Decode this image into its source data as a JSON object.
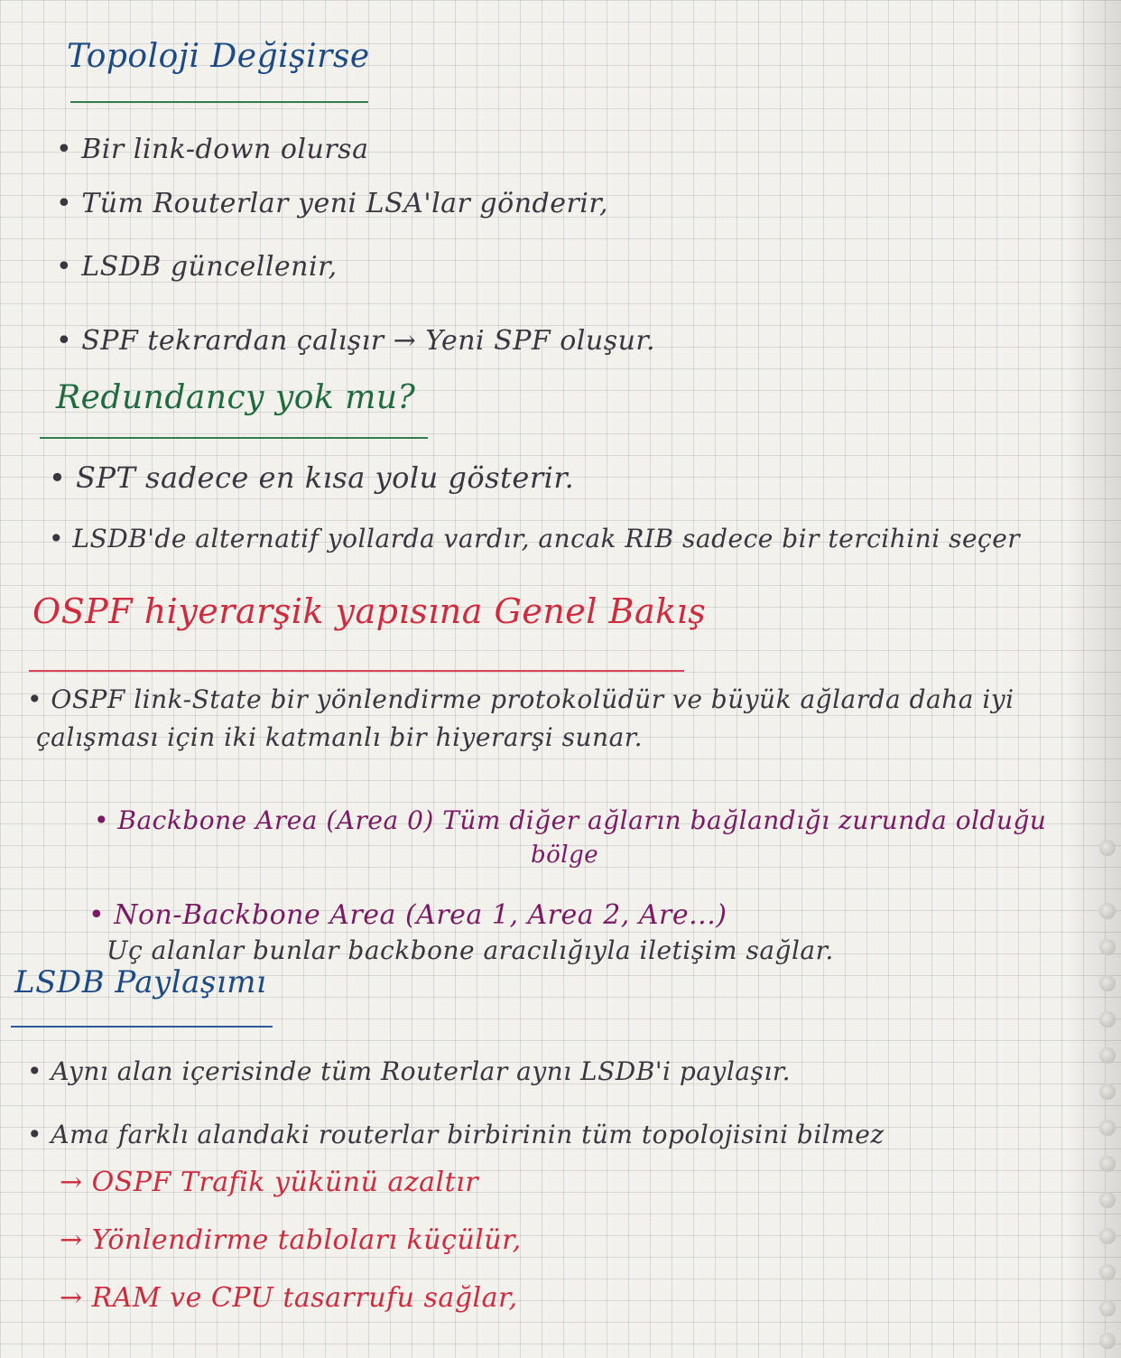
{
  "sections": [
    {
      "id": "topoloji",
      "heading": "Topoloji Değişirse",
      "lines": [
        "• Bir link-down olursa",
        "• Tüm Routerlar yeni LSA'lar gönderir,",
        "• LSDB güncellenir,",
        "• SPF tekrardan çalışır → Yeni SPF oluşur."
      ]
    },
    {
      "id": "redundancy",
      "heading": "Redundancy yok mu?",
      "lines": [
        "• SPT sadece en kısa yolu gösterir.",
        "• LSDB'de alternatif yollarda vardır, ancak RIB sadece bir tercihini seçer"
      ]
    },
    {
      "id": "ospf",
      "heading": "OSPF hiyerarşik yapısına Genel Bakış",
      "lines": [
        "• OSPF link-State bir yönlendirme protokolüdür ve büyük ağlarda daha iyi",
        "çalışması için iki katmanlı bir hiyerarşi sunar.",
        "• Backbone Area (Area 0) Tüm diğer ağların bağlandığı zurunda olduğu",
        "bölge",
        "• Non-Backbone Area (Area 1, Area 2, Are...)",
        "Uç alanlar bunlar backbone aracılığıyla iletişim sağlar."
      ]
    },
    {
      "id": "lsdb",
      "heading": "LSDB Paylaşımı",
      "lines": [
        "• Aynı alan içerisinde tüm Routerlar aynı LSDB'i paylaşır.",
        "• Ama farklı alandaki routerlar birbirinin tüm topolojisini bilmez",
        "→ OSPF Trafik yükünü azaltır",
        "→ Yönlendirme tabloları küçülür,",
        "→ RAM ve CPU tasarrufu sağlar,"
      ]
    }
  ],
  "colors": {
    "ink_green": "#1f6a3e",
    "ink_red": "#d02a3e",
    "ink_purple": "#7a1a63",
    "ink_blue": "#1c4a86",
    "ink_dark": "#3b3540",
    "paper": "#f3f1ec"
  },
  "binding_hole_icon": "spiral-hole-icon"
}
